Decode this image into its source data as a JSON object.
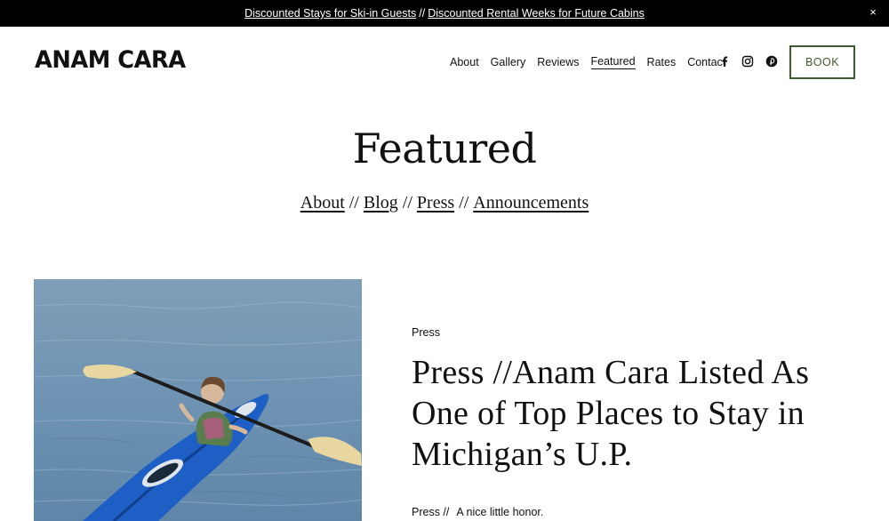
{
  "announcement": {
    "link1": "Discounted Stays for Ski-in Guests",
    "separator": "//",
    "link2": "Discounted Rental Weeks for Future Cabins",
    "close": "×"
  },
  "header": {
    "logo": "ANAM CARA",
    "nav": [
      "About",
      "Gallery",
      "Reviews",
      "Featured",
      "Rates",
      "Contact"
    ],
    "active_nav": "Featured",
    "social_icons": [
      "facebook-icon",
      "instagram-icon",
      "pinterest-icon"
    ],
    "book_label": "BOOK",
    "book_color": "#3f5a2c"
  },
  "page": {
    "title": "Featured",
    "subnav": [
      "About",
      "Blog",
      "Press",
      "Announcements"
    ],
    "subnav_separator": "//"
  },
  "post": {
    "category": "Press",
    "title": "Press //Anam Cara Listed As One of Top Places to Stay in Michigan’s U.P.",
    "excerpt_prefix": "Press //",
    "excerpt_text": "A nice little honor."
  }
}
